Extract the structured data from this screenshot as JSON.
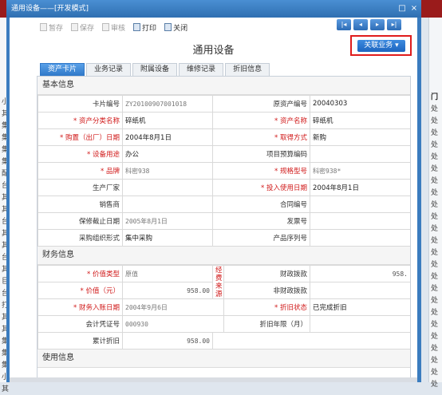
{
  "background": {
    "left_col": [
      "小",
      "其",
      "集",
      "集",
      "集",
      "集",
      "配",
      "台",
      "其",
      "其",
      "台",
      "其",
      "其",
      "台",
      "其",
      "巨",
      "台",
      "打",
      "其",
      "其",
      "集",
      "集",
      "集",
      "小",
      "其"
    ],
    "right_col": [
      "门",
      "处",
      "处",
      "处",
      "处",
      "处",
      "处",
      "处",
      "处",
      "处",
      "处",
      "处",
      "处",
      "处",
      "处",
      "处",
      "处",
      "处",
      "处",
      "处",
      "处",
      "处",
      "处",
      "处",
      "处"
    ]
  },
  "dialog": {
    "title": "通用设备——[开发模式]",
    "restore_icon": "□",
    "close_icon": "×"
  },
  "toolbar": {
    "buttons": [
      {
        "label": "暂存",
        "icon": "save-draft-icon",
        "enabled": false
      },
      {
        "label": "保存",
        "icon": "save-icon",
        "enabled": false
      },
      {
        "label": "审核",
        "icon": "audit-icon",
        "enabled": false
      },
      {
        "label": "打印",
        "icon": "print-icon",
        "enabled": true
      },
      {
        "label": "关闭",
        "icon": "close-doc-icon",
        "enabled": true
      }
    ],
    "nav": [
      "|◂",
      "◂",
      "▸",
      "▸|"
    ]
  },
  "page_title": "通用设备",
  "related_button": "关联业务 ▾",
  "tabs": [
    {
      "label": "资产卡片",
      "active": true
    },
    {
      "label": "业务记录",
      "active": false
    },
    {
      "label": "附属设备",
      "active": false
    },
    {
      "label": "维修记录",
      "active": false
    },
    {
      "label": "折旧信息",
      "active": false
    }
  ],
  "sections": {
    "basic": "基本信息",
    "finance": "财务信息",
    "usage": "使用信息"
  },
  "basic": {
    "card_no": {
      "label": "卡片编号",
      "value": "ZY20100907001018"
    },
    "orig_no": {
      "label": "原资产编号",
      "value": "20040303"
    },
    "category": {
      "label": "* 资产分类名称",
      "value": "碎纸机"
    },
    "name": {
      "label": "* 资产名称",
      "value": "碎纸机"
    },
    "purchase_date": {
      "label": "* 购置（出厂）日期",
      "value": "2004年8月1日"
    },
    "acquire_method": {
      "label": "* 取得方式",
      "value": "新购"
    },
    "usage": {
      "label": "* 设备用途",
      "value": "办公"
    },
    "budget_code": {
      "label": "项目预算编码",
      "value": ""
    },
    "brand": {
      "label": "* 品牌",
      "value": "科密938"
    },
    "model": {
      "label": "* 规格型号",
      "value": "科密938*"
    },
    "maker": {
      "label": "生产厂家",
      "value": ""
    },
    "use_date": {
      "label": "* 投入使用日期",
      "value": "2004年8月1日"
    },
    "seller": {
      "label": "销售商",
      "value": ""
    },
    "contract_no": {
      "label": "合同编号",
      "value": ""
    },
    "warranty": {
      "label": "保修截止日期",
      "value": "2005年8月1日"
    },
    "invoice_no": {
      "label": "发票号",
      "value": ""
    },
    "purchase_form": {
      "label": "采购组织形式",
      "value": "集中采购"
    },
    "serial_no": {
      "label": "产品序列号",
      "value": ""
    }
  },
  "finance": {
    "value_type": {
      "label": "* 价值类型",
      "value": "原值"
    },
    "source_label": "经费来源",
    "fiscal": {
      "label": "财政拨款",
      "value": "958."
    },
    "value": {
      "label": "* 价值（元）",
      "value": "958.00"
    },
    "nonfiscal": {
      "label": "非财政拨款",
      "value": ""
    },
    "entry_date": {
      "label": "* 财务入账日期",
      "value": "2004年9月6日"
    },
    "dep_status": {
      "label": "* 折旧状态",
      "value": "已完成折旧"
    },
    "voucher": {
      "label": "会计凭证号",
      "value": "000930"
    },
    "dep_years": {
      "label": "折旧年限（月）",
      "value": ""
    },
    "accum_dep": {
      "label": "累计折旧",
      "value": "958.00"
    }
  }
}
